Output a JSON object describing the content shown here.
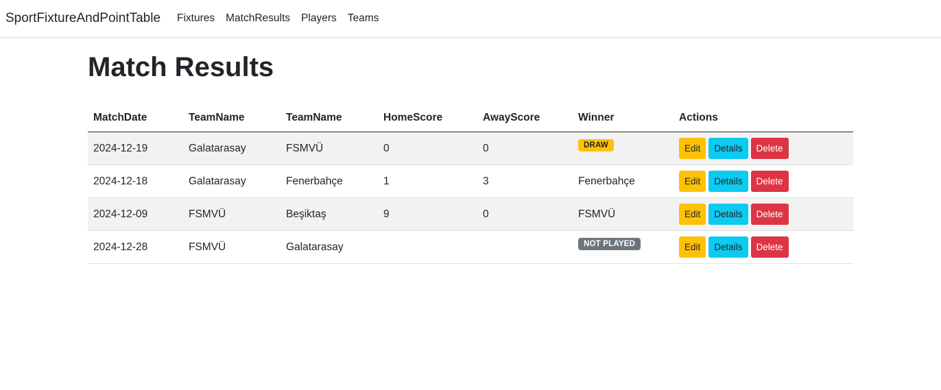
{
  "navbar": {
    "brand": "SportFixtureAndPointTable",
    "links": [
      "Fixtures",
      "MatchResults",
      "Players",
      "Teams"
    ]
  },
  "page": {
    "title": "Match Results"
  },
  "table": {
    "headers": [
      "MatchDate",
      "TeamName",
      "TeamName",
      "HomeScore",
      "AwayScore",
      "Winner",
      "Actions"
    ],
    "rows": [
      {
        "date": "2024-12-19",
        "home": "Galatarasay",
        "away": "FSMVÜ",
        "home_score": "0",
        "away_score": "0",
        "winner": "DRAW",
        "winner_type": "badge-warning"
      },
      {
        "date": "2024-12-18",
        "home": "Galatarasay",
        "away": "Fenerbahçe",
        "home_score": "1",
        "away_score": "3",
        "winner": "Fenerbahçe",
        "winner_type": "text"
      },
      {
        "date": "2024-12-09",
        "home": "FSMVÜ",
        "away": "Beşiktaş",
        "home_score": "9",
        "away_score": "0",
        "winner": "FSMVÜ",
        "winner_type": "text"
      },
      {
        "date": "2024-12-28",
        "home": "FSMVÜ",
        "away": "Galatarasay",
        "home_score": "",
        "away_score": "",
        "winner": "NOT PLAYED",
        "winner_type": "badge-secondary"
      }
    ],
    "actions": {
      "edit_label": "Edit",
      "details_label": "Details",
      "delete_label": "Delete"
    }
  },
  "colors": {
    "edit": "#ffc107",
    "details": "#0dcaf0",
    "delete": "#dc3545",
    "draw_badge": "#ffc107",
    "not_played_badge": "#6c757d",
    "stripe": "#f2f2f2"
  }
}
